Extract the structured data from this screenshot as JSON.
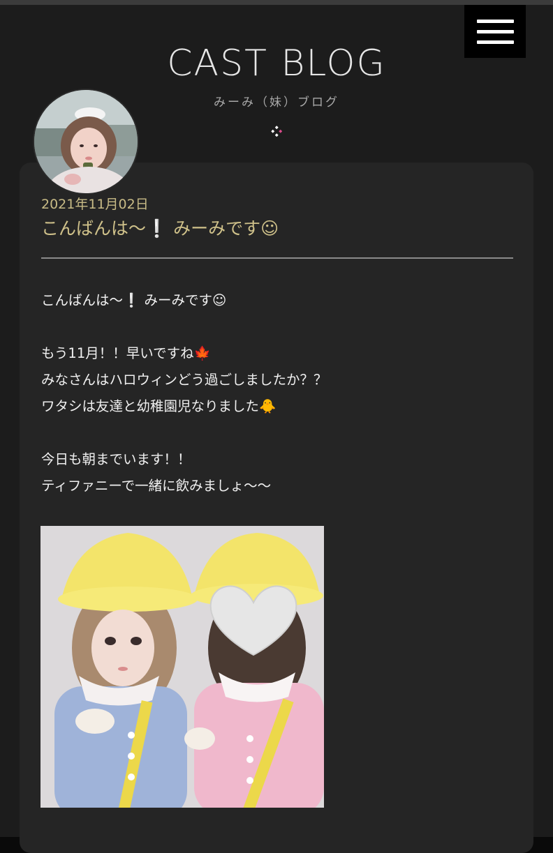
{
  "header": {
    "title": "CAST BLOG",
    "subtitle": "みーみ（妹）ブログ",
    "menu_icon": "hamburger-menu-icon",
    "ornament_icon": "diamond-ornament-icon"
  },
  "post": {
    "date": "2021年11月02日",
    "title": "こんばんは〜❕ みーみです☺︎",
    "body_lines": [
      "こんばんは〜❕ みーみです☺︎",
      "",
      "もう11月！！早いですね🍁",
      "みなさんはハロウィンどう過ごしましたか？？",
      "ワタシは友達と幼稚園児なりました🐥",
      "",
      "今日も朝までいます！！",
      "ティファニーで一緒に飲みましょ〜〜"
    ]
  },
  "colors": {
    "accent": "#cfc18a",
    "background": "#1c1c1c",
    "card": "#252525",
    "text": "#f0f0f0"
  }
}
